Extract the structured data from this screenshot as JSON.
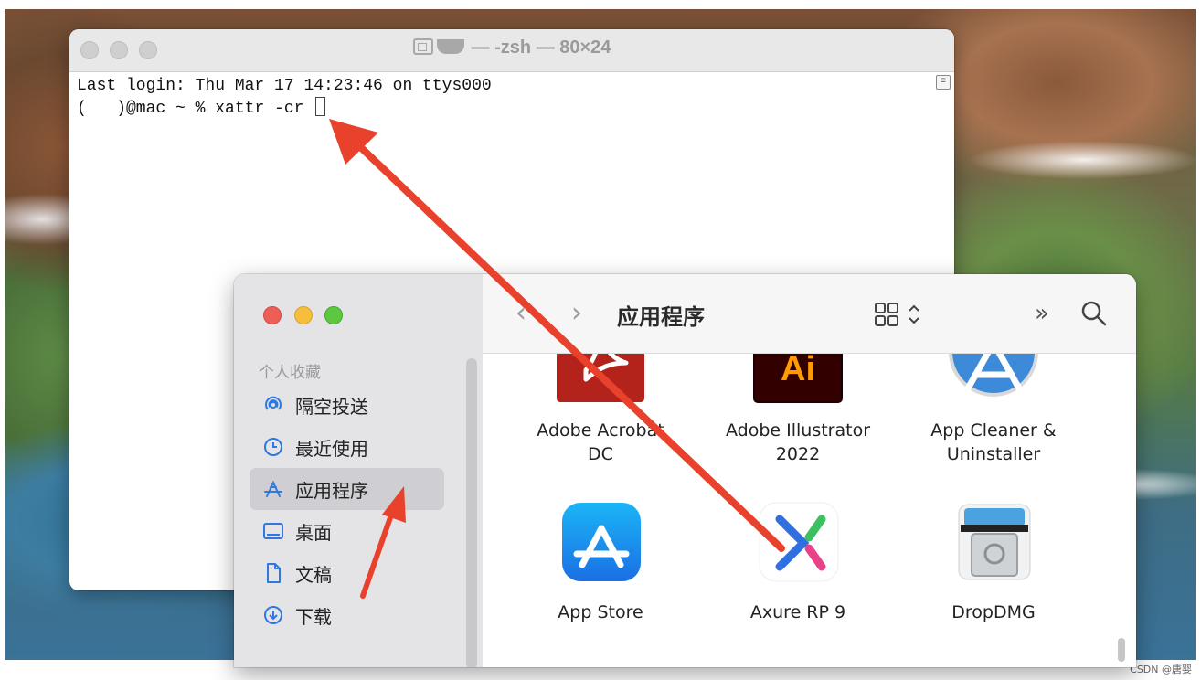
{
  "terminal": {
    "title": "— -zsh — 80×24",
    "line1": "Last login: Thu Mar 17 14:23:46 on ttys000",
    "prompt_user": "(   )@mac ~ % ",
    "command": "xattr -cr "
  },
  "finder": {
    "toolbar_title": "应用程序",
    "sidebar_heading": "个人收藏",
    "sidebar_items": [
      {
        "label": "隔空投送",
        "icon": "airdrop-icon"
      },
      {
        "label": "最近使用",
        "icon": "clock-icon"
      },
      {
        "label": "应用程序",
        "icon": "applications-icon",
        "selected": true
      },
      {
        "label": "桌面",
        "icon": "desktop-icon"
      },
      {
        "label": "文稿",
        "icon": "document-icon"
      },
      {
        "label": "下载",
        "icon": "download-icon"
      }
    ],
    "apps": [
      {
        "line1": "Adobe Acrobat",
        "line2": "DC"
      },
      {
        "line1": "Adobe Illustrator",
        "line2": "2022",
        "icon_text": "Ai"
      },
      {
        "line1": "App Cleaner &",
        "line2": "Uninstaller"
      },
      {
        "line1": "App Store",
        "line2": ""
      },
      {
        "line1": "Axure RP 9",
        "line2": ""
      },
      {
        "line1": "DropDMG",
        "line2": ""
      }
    ]
  },
  "watermark": "CSDN @唐婴",
  "colors": {
    "annotation_arrow": "#e8412c",
    "sidebar_accent": "#2f78e0",
    "traffic_red": "#ec5f57",
    "traffic_yellow": "#f5be3d",
    "traffic_green": "#5cc83f"
  }
}
